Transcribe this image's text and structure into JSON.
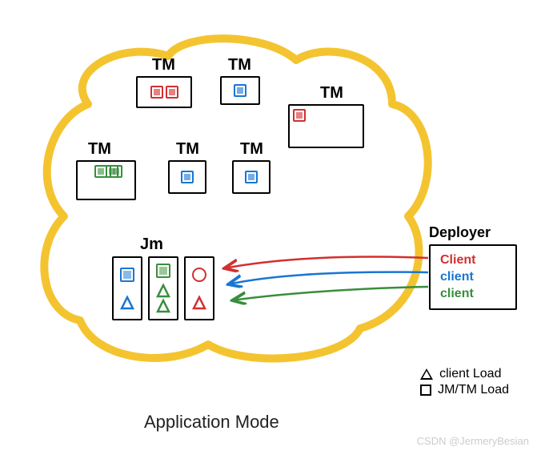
{
  "labels": {
    "tm1": "TM",
    "tm2": "TM",
    "tm3": "TM",
    "tm4": "TM",
    "tm5": "TM",
    "tm6": "TM",
    "jm": "Jm"
  },
  "deployer": {
    "title": "Deployer",
    "clients": {
      "red": "Client",
      "blue": "client",
      "green": "client"
    }
  },
  "legend": {
    "triangle": "client Load",
    "square": "JM/TM Load"
  },
  "caption": "Application Mode",
  "watermark": "CSDN @JermeryBesian"
}
